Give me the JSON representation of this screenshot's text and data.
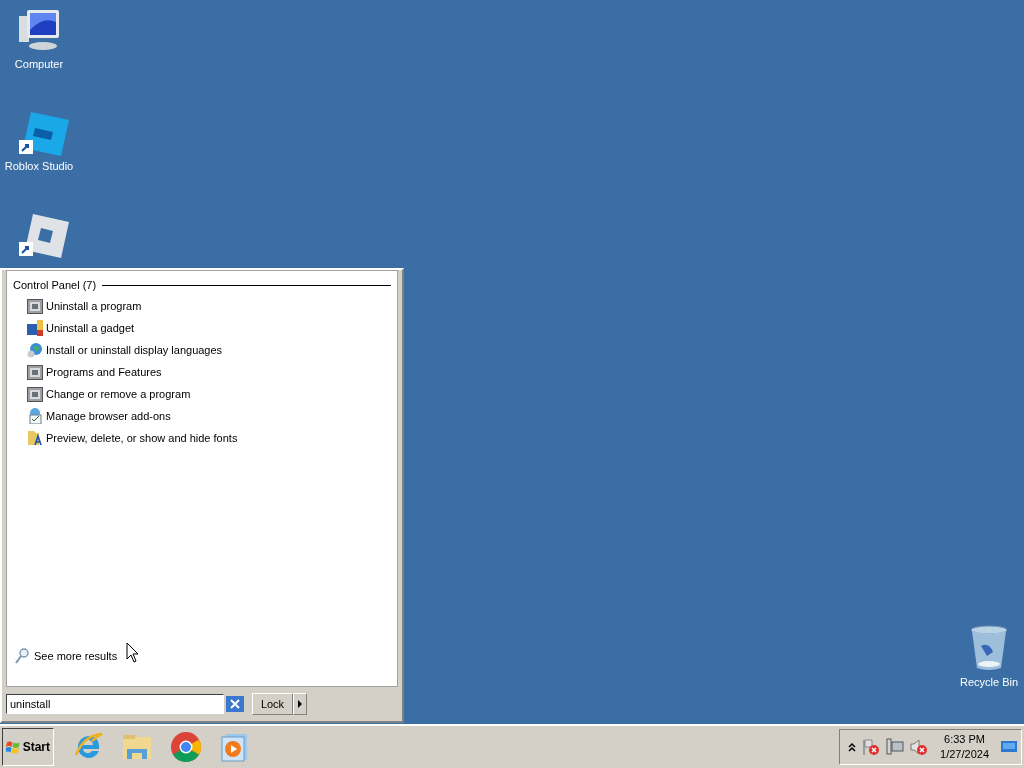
{
  "desktop_icons": [
    {
      "kind": "computer",
      "label": "Computer"
    },
    {
      "kind": "studio",
      "label": "Roblox Studio"
    },
    {
      "kind": "player"
    },
    {
      "kind": "recycle",
      "label": "Recycle Bin"
    }
  ],
  "start_menu": {
    "group_title": "Control Panel (7)",
    "items": [
      {
        "kind": "programs",
        "label": "Uninstall a program"
      },
      {
        "kind": "gadget",
        "label": "Uninstall a gadget"
      },
      {
        "kind": "globe",
        "label": "Install or uninstall display languages"
      },
      {
        "kind": "programs",
        "label": "Programs and Features"
      },
      {
        "kind": "programs",
        "label": "Change or remove a program"
      },
      {
        "kind": "addons",
        "label": "Manage browser add-ons"
      },
      {
        "kind": "fonts",
        "label": "Preview, delete, or show and hide fonts"
      }
    ],
    "see_more": "See more results",
    "search": {
      "value": "uninstall"
    },
    "lock_button": "Lock"
  },
  "taskbar": {
    "start": "Start",
    "pinned": [
      {
        "kind": "ie"
      },
      {
        "kind": "explorer"
      },
      {
        "kind": "chrome"
      },
      {
        "kind": "media"
      }
    ],
    "tray": {
      "time": "6:33 PM",
      "date": "1/27/2024"
    }
  }
}
